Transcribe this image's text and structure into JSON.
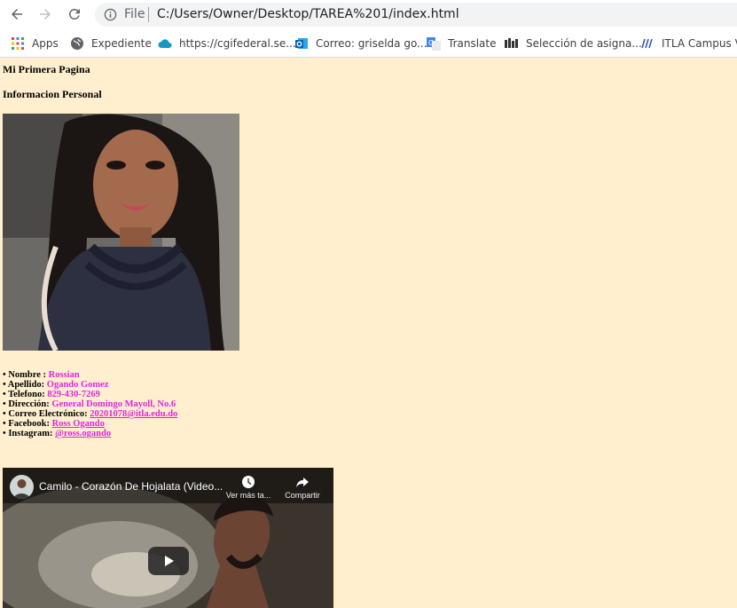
{
  "browser": {
    "scheme_label": "File",
    "url": "C:/Users/Owner/Desktop/TAREA%201/index.html",
    "bookmarks": [
      {
        "label": "Apps",
        "icon": "apps-grid-icon"
      },
      {
        "label": "Expediente",
        "icon": "globe-icon"
      },
      {
        "label": "https://cgifederal.se...",
        "icon": "cloud-icon"
      },
      {
        "label": "Correo: griselda go...",
        "icon": "outlook-icon"
      },
      {
        "label": "Translate",
        "icon": "translate-icon"
      },
      {
        "label": "Selección de asigna...",
        "icon": "schedule-icon"
      },
      {
        "label": "ITLA Campus Vir",
        "icon": "itla-icon"
      }
    ]
  },
  "page": {
    "title": "Mi Primera Pagina",
    "subtitle": "Informacion Personal",
    "info": [
      {
        "label": "Nombre :",
        "value": "Rossian"
      },
      {
        "label": "Apellido:",
        "value": "Ogando Gomez"
      },
      {
        "label": "Telefono:",
        "value": "829-430-7269"
      },
      {
        "label": "Dirección:",
        "value": "General Domingo Mayoll, No.6"
      },
      {
        "label": "Correo Electrónico:",
        "value": "20201078@itla.edu.do"
      },
      {
        "label": "Facebook:",
        "value": "Ross Ogando"
      },
      {
        "label": "Instagram:",
        "value": "@ross.ogando"
      }
    ],
    "video": {
      "title": "Camilo - Corazón De Hojalata (Video...",
      "watch_later": "Ver más ta...",
      "share": "Compartir"
    }
  },
  "colors": {
    "page_background": "#ffefcf",
    "value_text": "#e223e2"
  }
}
